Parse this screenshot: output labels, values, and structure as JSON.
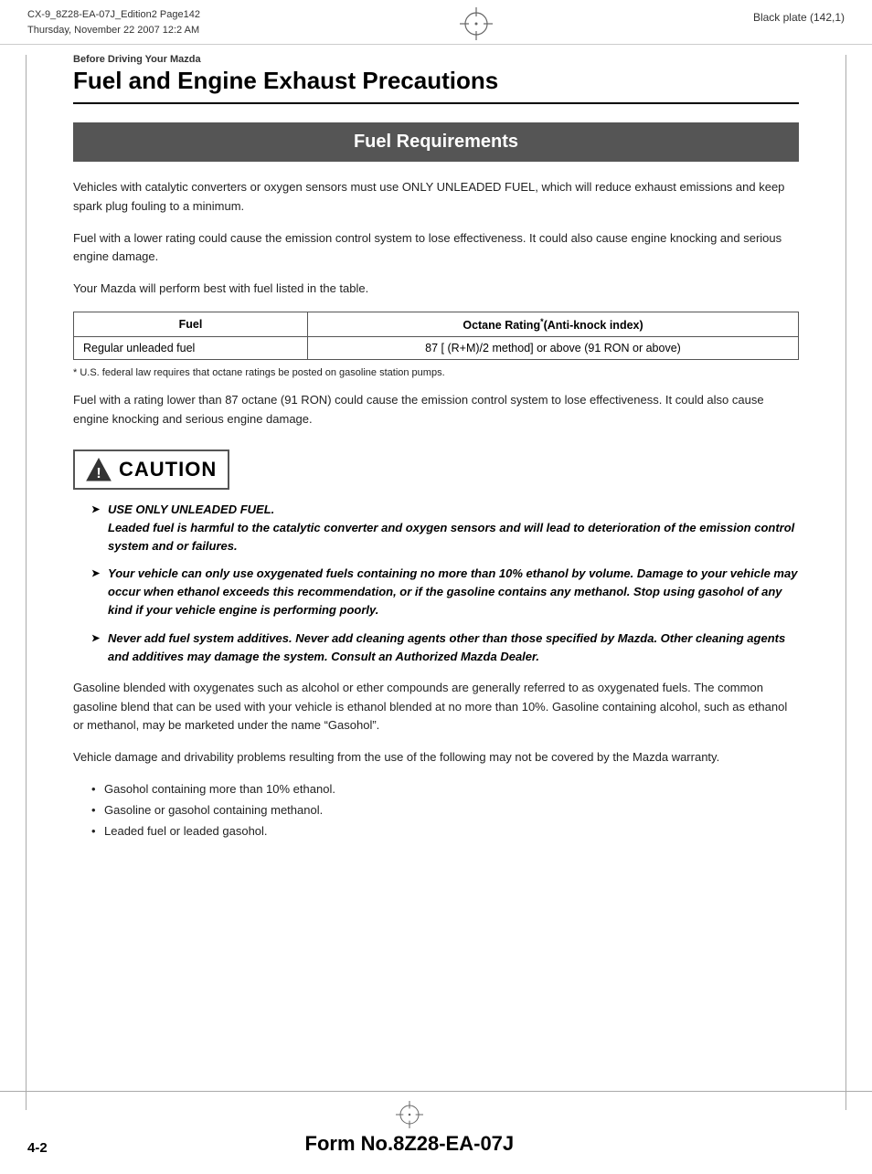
{
  "header": {
    "left_line1": "CX-9_8Z28-EA-07J_Edition2 Page142",
    "left_line2": "Thursday, November 22 2007 12:2 AM",
    "right_text": "Black plate (142,1)"
  },
  "section_label": "Before Driving Your Mazda",
  "page_title": "Fuel and Engine Exhaust Precautions",
  "fuel_requirements_heading": "Fuel Requirements",
  "paragraphs": {
    "p1": "Vehicles with catalytic converters or oxygen sensors must use ONLY UNLEADED FUEL, which will reduce exhaust emissions and keep spark plug fouling to a minimum.",
    "p2": "Fuel with a lower rating could cause the emission control system to lose effectiveness. It could also cause engine knocking and serious engine damage.",
    "p3": "Your Mazda will perform best with fuel listed in the table.",
    "p4": "Fuel with a rating lower than 87 octane (91 RON) could cause the emission control system to lose effectiveness. It could also cause engine knocking and serious engine damage.",
    "p5": "Gasoline blended with oxygenates such as alcohol or ether compounds are generally referred to as oxygenated fuels. The common gasoline blend that can be used with your vehicle is ethanol blended at no more than 10%. Gasoline containing alcohol, such as ethanol or methanol, may be marketed under the name “Gasohol”.",
    "p6": "Vehicle damage and drivability problems resulting from the use of the following may not be covered by the Mazda warranty."
  },
  "table": {
    "headers": [
      "Fuel",
      "Octane Rating*(Anti-knock index)"
    ],
    "rows": [
      [
        "Regular unleaded fuel",
        "87 [ (R+M)/2 method] or above (91 RON or above)"
      ]
    ],
    "footnote": "*  U.S. federal law requires that octane ratings be posted on gasoline station pumps."
  },
  "caution": {
    "label": "CAUTION",
    "items": [
      {
        "first_line": "USE ONLY UNLEADED FUEL.",
        "rest": "Leaded fuel is harmful to the catalytic converter and oxygen sensors and will lead to deterioration of the emission control system and or failures."
      },
      {
        "rest": "Your vehicle can only use oxygenated fuels containing no more than 10% ethanol by volume. Damage to your vehicle may occur when ethanol exceeds this recommendation, or if the gasoline contains any methanol. Stop using gasohol of any kind if your vehicle engine is performing poorly."
      },
      {
        "rest": "Never add fuel system additives. Never add cleaning agents other than those specified by Mazda. Other cleaning agents and additives may damage the system. Consult an Authorized Mazda Dealer."
      }
    ]
  },
  "bullet_list": {
    "items": [
      "Gasohol containing more than 10% ethanol.",
      "Gasoline or gasohol containing methanol.",
      "Leaded fuel or leaded gasohol."
    ]
  },
  "footer": {
    "page_number": "4-2",
    "form_number": "Form No.8Z28-EA-07J"
  }
}
